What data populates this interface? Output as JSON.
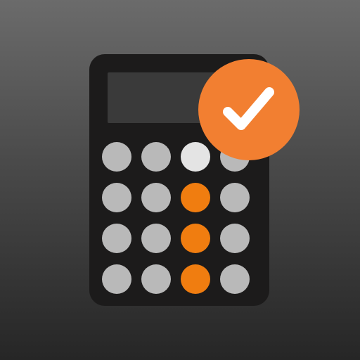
{
  "icon": {
    "name": "calculator-check-app-icon",
    "background_colors": [
      "#6b6b6b",
      "#262626"
    ],
    "body_color": "#1c1b1b",
    "display_color": "#3a3a3a",
    "badge": {
      "icon": "check-icon",
      "color": "#f27f31",
      "mark_color": "#ffffff"
    },
    "keypad": {
      "rows": 4,
      "columns": 4,
      "colors": {
        "default": "#b9b9b9",
        "highlight": "#e4e4e4",
        "accent": "#f07d10"
      },
      "keys": [
        "default",
        "default",
        "highlight",
        "default",
        "default",
        "default",
        "accent",
        "default",
        "default",
        "default",
        "accent",
        "default",
        "default",
        "default",
        "accent",
        "default"
      ]
    }
  }
}
